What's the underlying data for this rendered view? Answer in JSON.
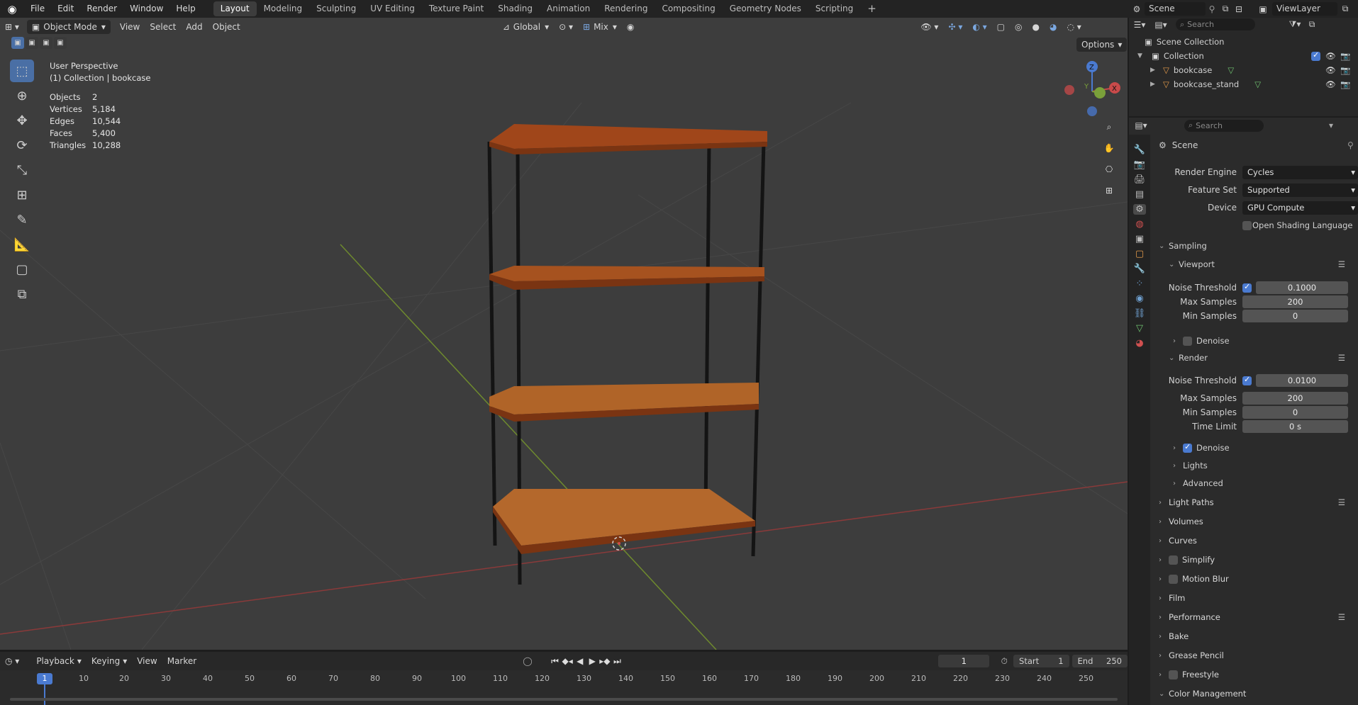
{
  "topbar": {
    "menus": [
      "File",
      "Edit",
      "Render",
      "Window",
      "Help"
    ],
    "workspaces": [
      "Layout",
      "Modeling",
      "Sculpting",
      "UV Editing",
      "Texture Paint",
      "Shading",
      "Animation",
      "Rendering",
      "Compositing",
      "Geometry Nodes",
      "Scripting"
    ],
    "active_workspace": "Layout",
    "add_tab": "+",
    "scene_name": "Scene",
    "view_layer": "ViewLayer"
  },
  "vp_header": {
    "mode": "Object Mode",
    "menus": [
      "View",
      "Select",
      "Add",
      "Object"
    ],
    "transform": "Global",
    "snap": "Mix",
    "options": "Options"
  },
  "stats": {
    "view": "User Perspective",
    "context": "(1) Collection | bookcase",
    "rows": [
      {
        "k": "Objects",
        "v": "2"
      },
      {
        "k": "Vertices",
        "v": "5,184"
      },
      {
        "k": "Edges",
        "v": "10,544"
      },
      {
        "k": "Faces",
        "v": "5,400"
      },
      {
        "k": "Triangles",
        "v": "10,288"
      }
    ]
  },
  "gizmo": {
    "x": "X",
    "y": "Y",
    "z": "Z"
  },
  "outliner": {
    "search": "Search",
    "scene_collection": "Scene Collection",
    "collection": "Collection",
    "items": [
      "bookcase",
      "bookcase_stand"
    ]
  },
  "props": {
    "search": "Search",
    "context": "Scene",
    "render_engine_label": "Render Engine",
    "render_engine": "Cycles",
    "feature_set_label": "Feature Set",
    "feature_set": "Supported",
    "device_label": "Device",
    "device": "GPU Compute",
    "osl": "Open Shading Language",
    "sampling": "Sampling",
    "viewport": "Viewport",
    "render": "Render",
    "noise_threshold": "Noise Threshold",
    "max_samples": "Max Samples",
    "min_samples": "Min Samples",
    "time_limit": "Time Limit",
    "vp_noise": "0.1000",
    "vp_max": "200",
    "vp_min": "0",
    "r_noise": "0.0100",
    "r_max": "200",
    "r_min": "0",
    "r_time": "0 s",
    "denoise": "Denoise",
    "lights": "Lights",
    "advanced": "Advanced",
    "panels": [
      "Light Paths",
      "Volumes",
      "Curves",
      "Simplify",
      "Motion Blur",
      "Film",
      "Performance",
      "Bake",
      "Grease Pencil",
      "Freestyle",
      "Color Management"
    ]
  },
  "timeline": {
    "menus": [
      "Playback",
      "Keying",
      "View",
      "Marker"
    ],
    "current": "1",
    "start_label": "Start",
    "start": "1",
    "end_label": "End",
    "end": "250",
    "ticks": [
      "1",
      "10",
      "20",
      "30",
      "40",
      "50",
      "60",
      "70",
      "80",
      "90",
      "100",
      "110",
      "120",
      "130",
      "140",
      "150",
      "160",
      "170",
      "180",
      "190",
      "200",
      "210",
      "220",
      "230",
      "240",
      "250"
    ]
  }
}
